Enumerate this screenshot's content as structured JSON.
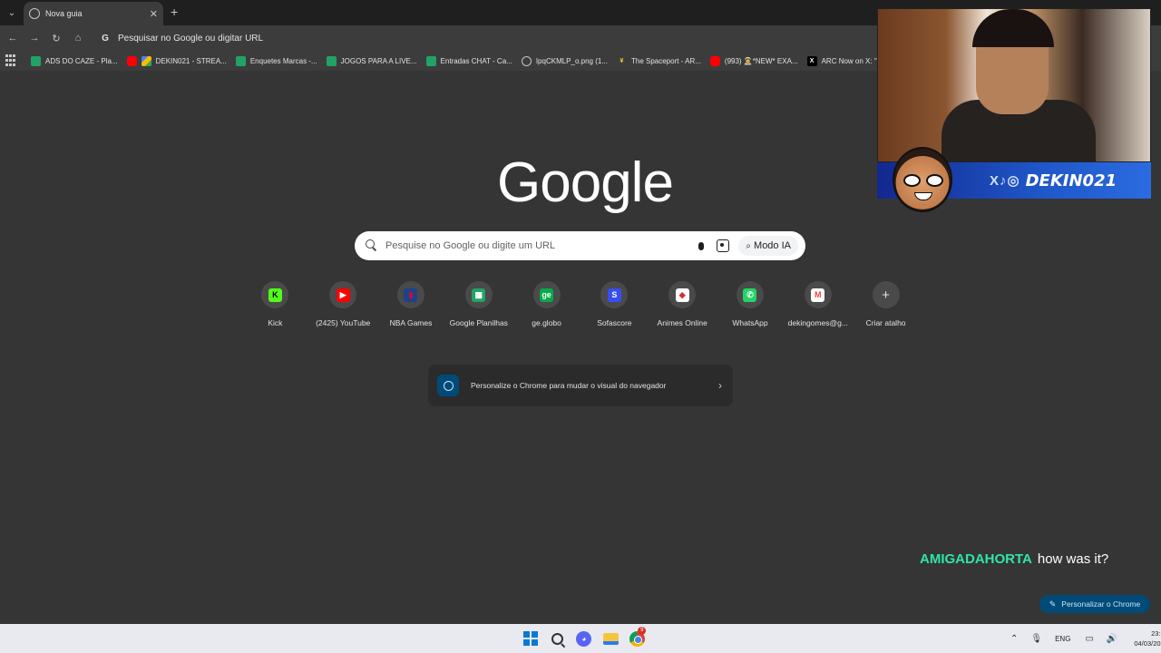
{
  "browser": {
    "tab": {
      "title": "Nova guia"
    },
    "omnibox": {
      "text": "Pesquisar no Google ou digitar URL"
    },
    "bookmarks": [
      {
        "label": "ADS DO CAZE - Pla...",
        "icon": "sheets-icon"
      },
      {
        "label": "DEKIN021 - STREA...",
        "icon": "drive-icon"
      },
      {
        "label": "Enquetes Marcas -...",
        "icon": "sheets-icon"
      },
      {
        "label": "JOGOS PARA A LIVE...",
        "icon": "sheets-icon"
      },
      {
        "label": "Entradas CHAT - Ca...",
        "icon": "sheets-icon"
      },
      {
        "label": "IpqCKMLP_o.png (1...",
        "icon": "globe-icon"
      },
      {
        "label": "The Spaceport - AR...",
        "icon": "ys-icon"
      },
      {
        "label": "(993) 👨‍🚀*NEW* EXA...",
        "icon": "youtube-icon"
      },
      {
        "label": "ARC Now on X: \"Co...",
        "icon": "x-icon"
      }
    ]
  },
  "newtab": {
    "logo": "Google",
    "search": {
      "placeholder": "Pesquise no Google ou digite um URL",
      "ai_mode_label": "Modo IA"
    },
    "shortcuts": [
      {
        "label": "Kick",
        "icon": "kick-icon",
        "glyph": "K",
        "color": "#53fc18",
        "fg": "#000000"
      },
      {
        "label": "(2425) YouTube",
        "icon": "youtube-icon",
        "glyph": "▶",
        "color": "#ff0000",
        "fg": "#ffffff"
      },
      {
        "label": "NBA Games",
        "icon": "nba-icon",
        "glyph": "▮",
        "color": "#1d428a",
        "fg": "#c8102e"
      },
      {
        "label": "Google Planilhas",
        "icon": "sheets-icon",
        "glyph": "▦",
        "color": "#21a366",
        "fg": "#ffffff"
      },
      {
        "label": "ge.globo",
        "icon": "ge-icon",
        "glyph": "ge",
        "color": "#06aa48",
        "fg": "#ffffff"
      },
      {
        "label": "Sofascore",
        "icon": "sofascore-icon",
        "glyph": "S",
        "color": "#374df5",
        "fg": "#ffffff"
      },
      {
        "label": "Animes Online",
        "icon": "animes-icon",
        "glyph": "◆",
        "color": "#ffffff",
        "fg": "#d32f2f"
      },
      {
        "label": "WhatsApp",
        "icon": "whatsapp-icon",
        "glyph": "✆",
        "color": "#25d366",
        "fg": "#ffffff"
      },
      {
        "label": "dekingomes@g...",
        "icon": "gmail-icon",
        "glyph": "M",
        "color": "#ffffff",
        "fg": "#ea4335"
      },
      {
        "label": "Criar atalho",
        "icon": "plus-icon",
        "glyph": "+",
        "color": "transparent",
        "fg": "#e3e3e3"
      }
    ],
    "customize_card": {
      "text": "Personalize o Chrome para mudar o visual do navegador"
    },
    "personalize_button": "Personalizar o Chrome"
  },
  "overlay": {
    "chat": {
      "user": "AMIGADAHORTA",
      "message": "how was it?"
    },
    "banner": {
      "socials": "X♪◎",
      "handle": "DEKIN021"
    }
  },
  "taskbar": {
    "language": "ENG",
    "time": "23:57",
    "date": "04/03/2026",
    "chrome_badge": "9"
  },
  "colors": {
    "accent": "#004a77",
    "chat_user": "#2ee6a8",
    "banner_blue": "#1f57c8"
  }
}
